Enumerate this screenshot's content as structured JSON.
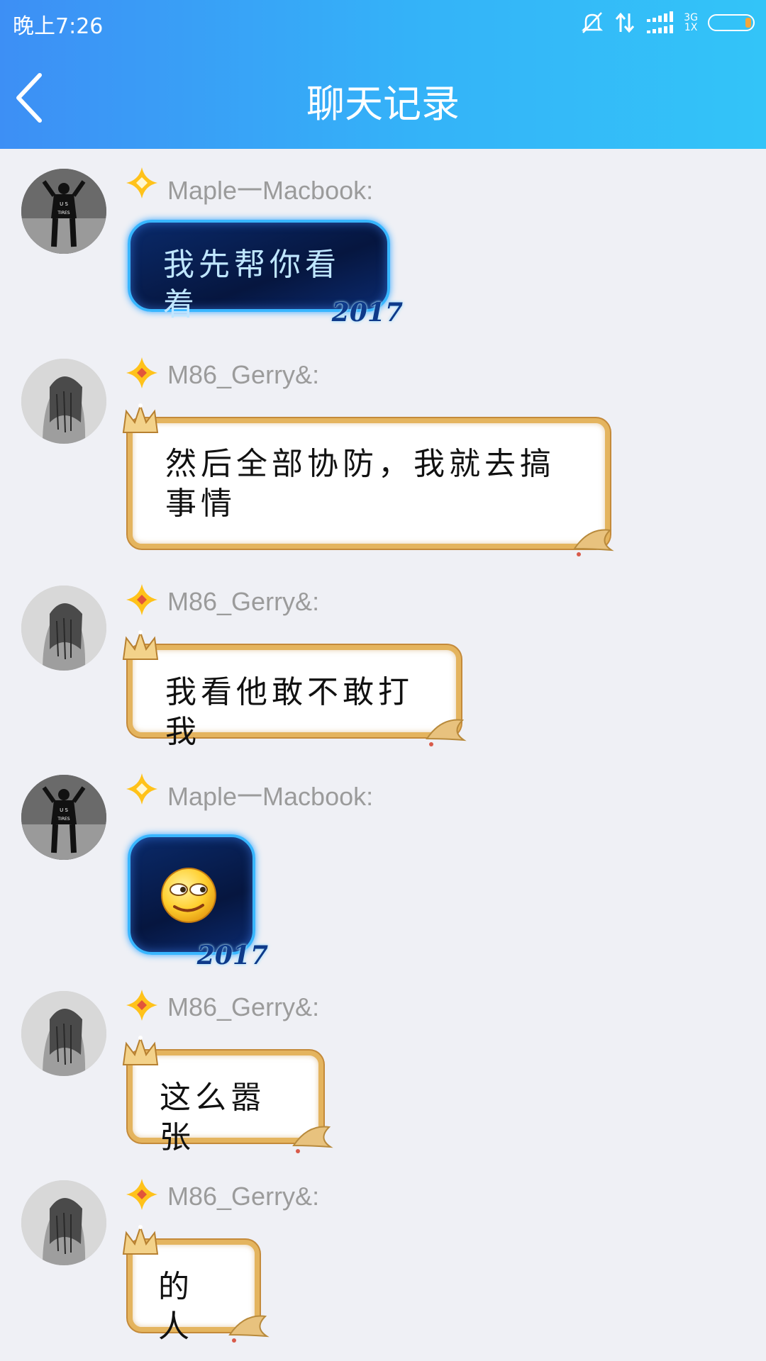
{
  "status_bar": {
    "time": "晚上7:26",
    "network_top": "3G",
    "network_bottom": "1X"
  },
  "header": {
    "title": "聊天记录"
  },
  "colors": {
    "header_start": "#3d8ff5",
    "header_end": "#33c4f8",
    "background": "#eff0f5",
    "sender_name": "#9b9b9b",
    "badge": "#ffc21a"
  },
  "messages": [
    {
      "sender": "Maple一Macbook:",
      "text": "我先帮你看着",
      "bubble": "dark-2017",
      "avatar": "maple-avatar"
    },
    {
      "sender": "M86_Gerry&:",
      "text": "然后全部协防，我就去搞事情",
      "bubble": "gold-frame",
      "avatar": "gerry-avatar"
    },
    {
      "sender": "M86_Gerry&:",
      "text": "我看他敢不敢打我",
      "bubble": "gold-frame",
      "avatar": "gerry-avatar"
    },
    {
      "sender": "Maple一Macbook:",
      "text": "",
      "emoji": "smirk-emoji",
      "bubble": "dark-2017",
      "avatar": "maple-avatar"
    },
    {
      "sender": "M86_Gerry&:",
      "text": "这么嚣张",
      "bubble": "gold-frame",
      "avatar": "gerry-avatar"
    },
    {
      "sender": "M86_Gerry&:",
      "text": "的人",
      "bubble": "gold-frame",
      "avatar": "gerry-avatar"
    }
  ],
  "bubble_tag": "2017"
}
